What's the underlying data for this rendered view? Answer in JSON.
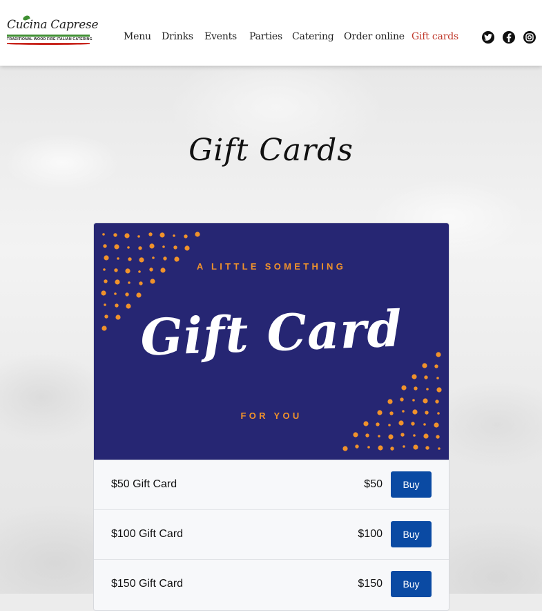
{
  "logo": {
    "name": "Cucina Caprese",
    "tagline": "TRADITIONAL WOOD FIRE ITALIAN CATERING"
  },
  "nav": {
    "items": [
      "Menu",
      "Drinks",
      "Events",
      "Parties",
      "Catering",
      "Order online",
      "Gift cards"
    ],
    "active": "Gift cards"
  },
  "social": {
    "icons": [
      "twitter-icon",
      "facebook-icon",
      "instagram-icon"
    ]
  },
  "page": {
    "title": "Gift Cards"
  },
  "gift_card_image": {
    "top_text": "A LITTLE SOMETHING",
    "main_text": "Gift Card",
    "bottom_text": "FOR YOU"
  },
  "products": [
    {
      "name": "$50 Gift Card",
      "price": "$50",
      "button": "Buy"
    },
    {
      "name": "$100 Gift Card",
      "price": "$100",
      "button": "Buy"
    },
    {
      "name": "$150 Gift Card",
      "price": "$150",
      "button": "Buy"
    }
  ],
  "colors": {
    "accent": "#c0392b",
    "card_bg": "#262673",
    "card_dots": "#f0922b",
    "buy_button": "#0a4aa3"
  }
}
